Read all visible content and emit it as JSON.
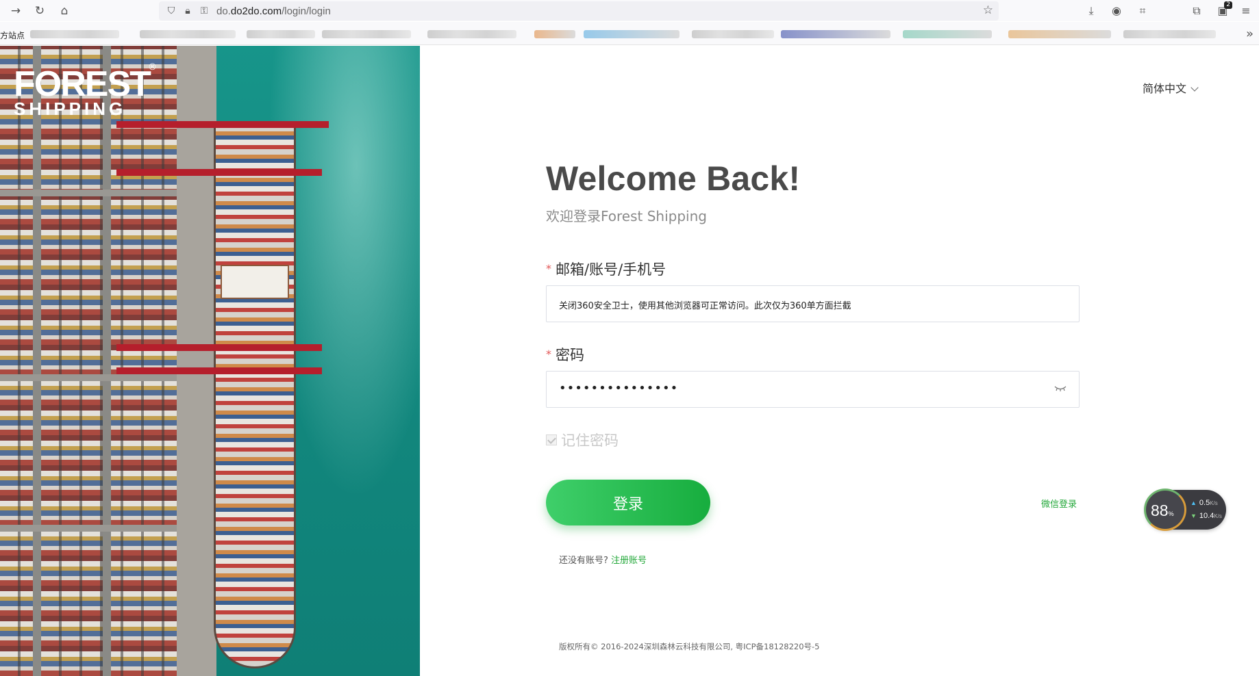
{
  "browser": {
    "url_prefix": "do.",
    "url_domain": "do2do.com",
    "url_path": "/login/login",
    "bookmark_first": "方站点",
    "extension_badge": "2"
  },
  "brand": {
    "logo_line1": "FOREST",
    "logo_line2": "SHIPPING",
    "registered_mark": "®"
  },
  "header": {
    "language": "简体中文"
  },
  "login": {
    "title": "Welcome Back!",
    "subtitle": "欢迎登录Forest Shipping",
    "account_label": "邮箱/账号/手机号",
    "account_value": "关闭360安全卫士，使用其他浏览器可正常访问。此次仅为360单方面拦截",
    "password_label": "密码",
    "password_mask": "•••••••••••••••",
    "required_mark": "*",
    "remember_label": "记住密码",
    "remember_checked": true,
    "login_button": "登录",
    "wechat_login": "微信登录",
    "no_account_text": "还没有账号?",
    "register_link": "注册账号"
  },
  "footer": {
    "copyright": "版权所有© 2016-2024深圳森林云科技有限公司, 粤ICP备18128220号-5"
  },
  "speed_widget": {
    "percent": "88",
    "percent_unit": "%",
    "upload": "0.5",
    "download": "10.4",
    "unit": "K/s"
  },
  "colors": {
    "accent_green": "#1fb14a",
    "link_green": "#23a83a",
    "required_red": "#e25555",
    "sea": "#138a80"
  }
}
